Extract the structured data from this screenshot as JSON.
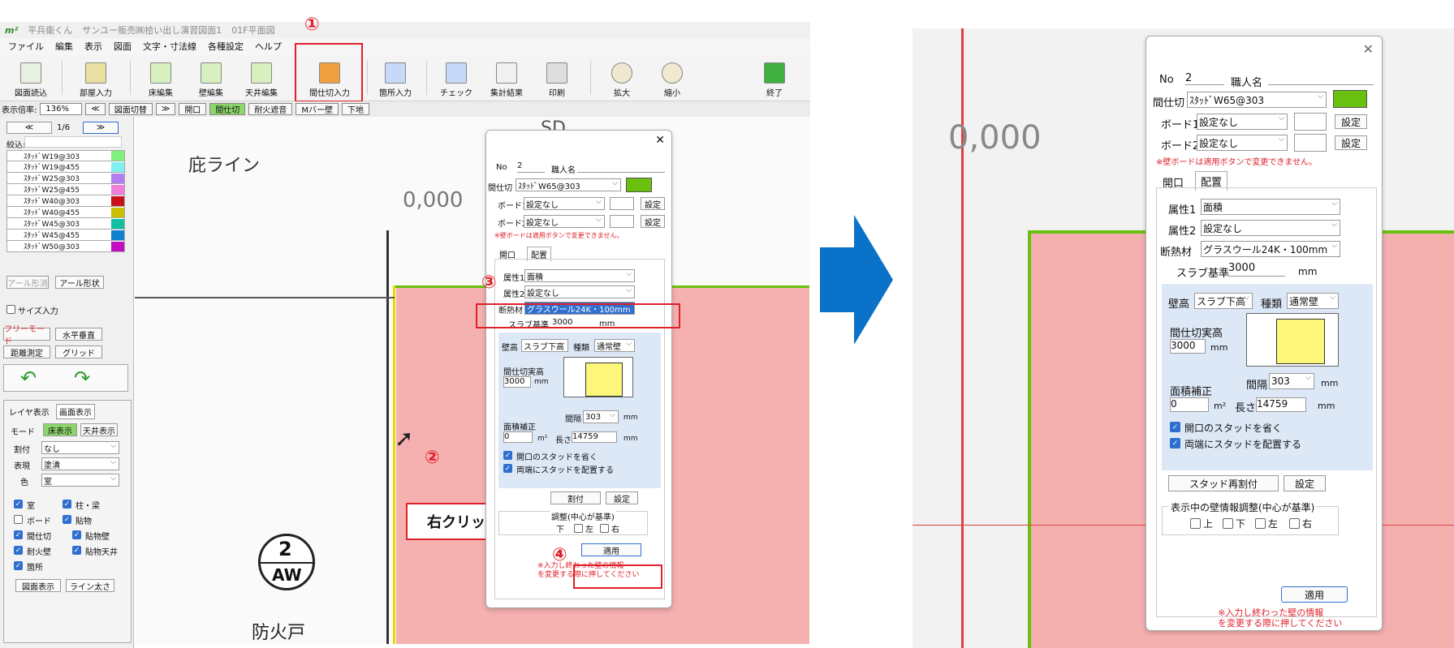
{
  "title": {
    "logo": "m²",
    "app": "平兵衛くん",
    "project": "サンユー販売㈱拾い出し演習図面1",
    "floor": "01F平面図"
  },
  "menu": [
    "ファイル",
    "編集",
    "表示",
    "図面",
    "文字・寸法線",
    "各種設定",
    "ヘルプ"
  ],
  "toolbar": [
    "図面読込",
    "部屋入力",
    "床編集",
    "壁編集",
    "天井編集",
    "間仕切入力",
    "箇所入力",
    "チェック",
    "集計結果",
    "印刷",
    "拡大",
    "縮小",
    "終了"
  ],
  "zoom": {
    "label": "表示倍率:",
    "value": "136%",
    "buttons": [
      "≪",
      "図面切替",
      "≫",
      "開口",
      "間仕切",
      "耐火遮音",
      "Mバー壁",
      "下地"
    ]
  },
  "sidebar": {
    "nav": [
      "≪",
      "1/6",
      "≫"
    ],
    "filter_label": "絞込:",
    "studs": [
      {
        "label": "ｽﾀｯﾄﾞW19@303",
        "color": "#7ef07e"
      },
      {
        "label": "ｽﾀｯﾄﾞW19@455",
        "color": "#7ef0f0"
      },
      {
        "label": "ｽﾀｯﾄﾞW25@303",
        "color": "#b07ef0"
      },
      {
        "label": "ｽﾀｯﾄﾞW25@455",
        "color": "#f07ed8"
      },
      {
        "label": "ｽﾀｯﾄﾞW40@303",
        "color": "#c8101a"
      },
      {
        "label": "ｽﾀｯﾄﾞW40@455",
        "color": "#c8c000"
      },
      {
        "label": "ｽﾀｯﾄﾞW45@303",
        "color": "#10c0a0"
      },
      {
        "label": "ｽﾀｯﾄﾞW45@455",
        "color": "#1080d0"
      },
      {
        "label": "ｽﾀｯﾄﾞW50@303",
        "color": "#c010c0"
      }
    ],
    "arc_buttons": [
      "アール形消",
      "アール形状"
    ],
    "size_input": "サイズ入力",
    "mode_buttons": [
      "フリーモード",
      "水平垂直",
      "距離測定",
      "グリッド"
    ],
    "tabs": [
      "レイヤ表示",
      "画面表示"
    ],
    "mode_label": "モード",
    "mode_opts": [
      "床表示",
      "天井表示"
    ],
    "rows": [
      {
        "label": "割付",
        "value": "なし"
      },
      {
        "label": "表現",
        "value": "塗潰"
      },
      {
        "label": "色",
        "value": "室"
      }
    ],
    "checks_left": [
      "室",
      "ボード",
      "間仕切",
      "耐火壁",
      "箇所"
    ],
    "checks_right": [
      "柱・梁",
      "貼物",
      "貼物壁",
      "貼物天井"
    ],
    "bottom_buttons": [
      "図面表示",
      "ライン太さ"
    ]
  },
  "drawing": {
    "text1": "庇ライン",
    "text2": "0,000",
    "text3": "SD",
    "bubble_num": "2",
    "bubble_code": "AW",
    "bottom_text": "防火戸",
    "callout": "右クリック"
  },
  "dialog": {
    "no_label": "No",
    "no_value": "2",
    "worker_label": "職人名",
    "partition_label": "間仕切",
    "partition_value": "ｽﾀｯﾄﾞW65@303",
    "board1_label": "ボード1",
    "board1_value": "設定なし",
    "board2_label": "ボード2",
    "board2_value": "設定なし",
    "set": "設定",
    "note": "※壁ボードは適用ボタンで変更できません。",
    "tabs": [
      "開口",
      "配置"
    ],
    "attr1_label": "属性1",
    "attr1_value": "面積",
    "attr2_label": "属性2",
    "attr2_value": "設定なし",
    "insulation_label": "断熱材",
    "insulation_value": "グラスウール24K・100mm",
    "slab_label": "スラブ基準",
    "slab_value": "3000",
    "mm": "mm",
    "wallh_label": "壁高",
    "wallh_value": "スラブ下高",
    "kind_label": "種類",
    "kind_value": "通常壁",
    "height_label": "間仕切実高",
    "height_value": "3000",
    "pitch_label": "間隔",
    "pitch_value": "303",
    "area_label": "面積補正",
    "area_value": "0",
    "m2": "m²",
    "length_label": "長さ",
    "length_value": "14759",
    "check1": "開口のスタッドを省く",
    "check2": "両端にスタッドを配置する",
    "restud": "スタッド再割付",
    "restud_short": "割付",
    "adjust_label": "表示中の壁情報調整(中心が基準)",
    "adjust_short": "調整(中心が基準)",
    "dirs": [
      "上",
      "下",
      "左",
      "右"
    ],
    "apply": "適用",
    "warn1": "※入力し終わった壁の情報",
    "warn2": "を変更する際に押してください"
  },
  "markers": [
    "①",
    "②",
    "③",
    "④"
  ],
  "colors": {
    "accent": "#e0202a",
    "blue": "#0a72c8",
    "green": "#6ac00e",
    "pink": "#f4a7a7"
  }
}
